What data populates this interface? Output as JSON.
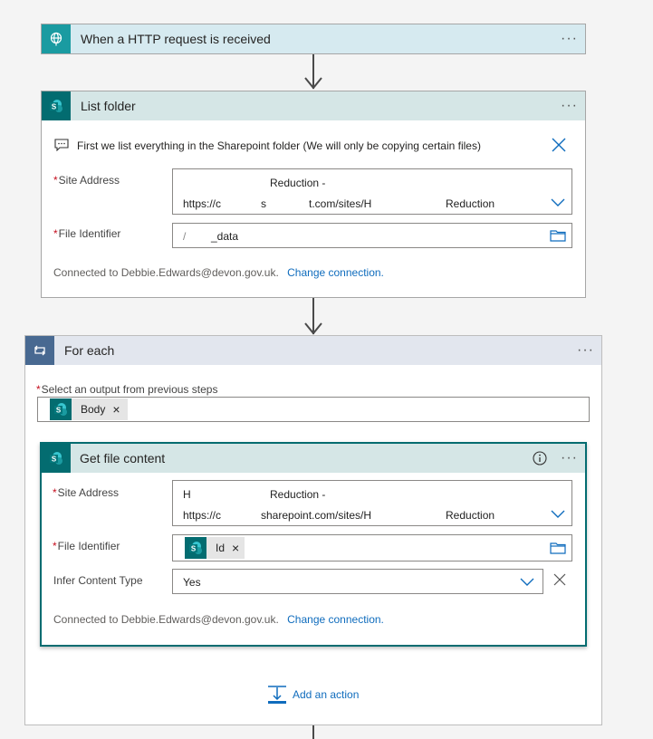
{
  "trigger": {
    "title": "When a HTTP request is received",
    "more": "···"
  },
  "list_folder": {
    "title": "List folder",
    "more": "···",
    "comment": "First we list everything in the Sharepoint folder (We will only be copying certain files)",
    "site_address_label": "Site Address",
    "site_address_line1": "Reduction -",
    "site_address_line2_a": "https://c",
    "site_address_line2_b": "s",
    "site_address_line2_c": "t.com/sites/H",
    "site_address_line2_d": "Reduction",
    "file_identifier_label": "File Identifier",
    "file_identifier_a": "/",
    "file_identifier_b": "_data",
    "connected_text": "Connected to Debbie.Edwards@devon.gov.uk.",
    "change_connection": "Change connection."
  },
  "for_each": {
    "title": "For each",
    "more": "···",
    "select_label": "Select an output from previous steps",
    "token_label": "Body",
    "token_remove": "×"
  },
  "get_file": {
    "title": "Get file content",
    "more": "···",
    "site_address_label": "Site Address",
    "site_address_line1_a": "H",
    "site_address_line1_b": "Reduction -",
    "site_address_line2_a": "https://c",
    "site_address_line2_b": "sharepoint.com/sites/H",
    "site_address_line2_c": "Reduction",
    "file_identifier_label": "File Identifier",
    "token_label": "Id",
    "token_remove": "×",
    "infer_label": "Infer Content Type",
    "infer_value": "Yes",
    "connected_text": "Connected to Debbie.Edwards@devon.gov.uk.",
    "change_connection": "Change connection."
  },
  "add_action": {
    "label": "Add an action"
  },
  "colors": {
    "trigger_header": "#d6eaf0",
    "trigger_icon": "#1a9ba1",
    "sharepoint_header": "#d5e6e6",
    "sharepoint_icon": "#036c70",
    "foreach_header": "#e2e6ee",
    "foreach_icon": "#486991",
    "link": "#0f6cbd"
  }
}
